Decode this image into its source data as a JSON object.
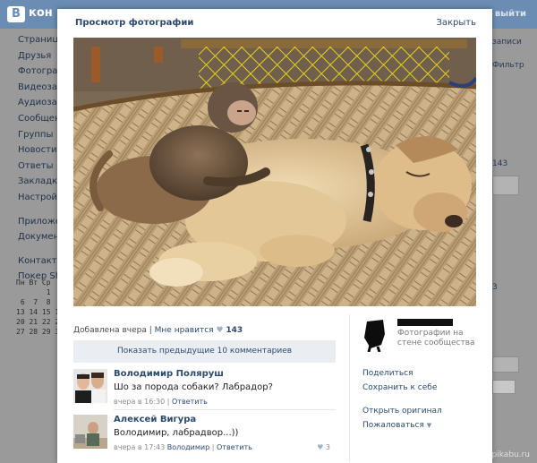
{
  "background": {
    "logo_letter": "В",
    "logo_text": "кон",
    "exit_label": "выйти",
    "menu": [
      "Страница",
      "Друзья",
      "Фотографи",
      "Видеозап",
      "Аудиозапи",
      "Сообщени",
      "Группы",
      "Новости",
      "Ответы",
      "Закладки",
      "Настройки",
      "",
      "Приложен",
      "Документ",
      "",
      "Контактер",
      "Покер Sha"
    ],
    "calendar": [
      "Пн Вт Ср",
      "       1  2",
      " 6  7  8  9",
      "13 14 15 16",
      "20 21 22 23",
      "27 28 29 30"
    ],
    "right": {
      "post_label": "записи",
      "filter_label": "Фильтр",
      "count_143": "143",
      "count_3": "3"
    },
    "footer": "pikabu.ru"
  },
  "modal": {
    "title": "Просмотр фотографии",
    "close_label": "Закрыть",
    "meta": {
      "added": "Добавлена вчера",
      "separator": "|",
      "like_label": "Мне нравится",
      "heart": "♥",
      "like_count": "143"
    },
    "show_previous": "Показать предыдущие 10 комментариев",
    "comments": [
      {
        "author": "Володимир Поляруш",
        "text": "Шо за порода собаки? Лабрадор?",
        "time": "вчера в 16:30",
        "separator": "|",
        "reply_label": "Ответить",
        "likes": ""
      },
      {
        "author": "Алексей Вигура",
        "text": "Володимир, лабрадвор...))",
        "time": "вчера в 17:43",
        "mention": "Володимир",
        "separator": "|",
        "reply_label": "Ответить",
        "heart": "♥",
        "likes": "3"
      }
    ],
    "author": {
      "subtitle": "Фотографии на стене сообщества"
    },
    "actions": [
      "Поделиться",
      "Сохранить к себе",
      "Открыть оригинал",
      "Пожаловаться"
    ],
    "report_caret": "▼"
  },
  "colors": {
    "link": "#2b4a6e",
    "topbar": "#6b8db3",
    "overlay": "#5e5e5e"
  }
}
